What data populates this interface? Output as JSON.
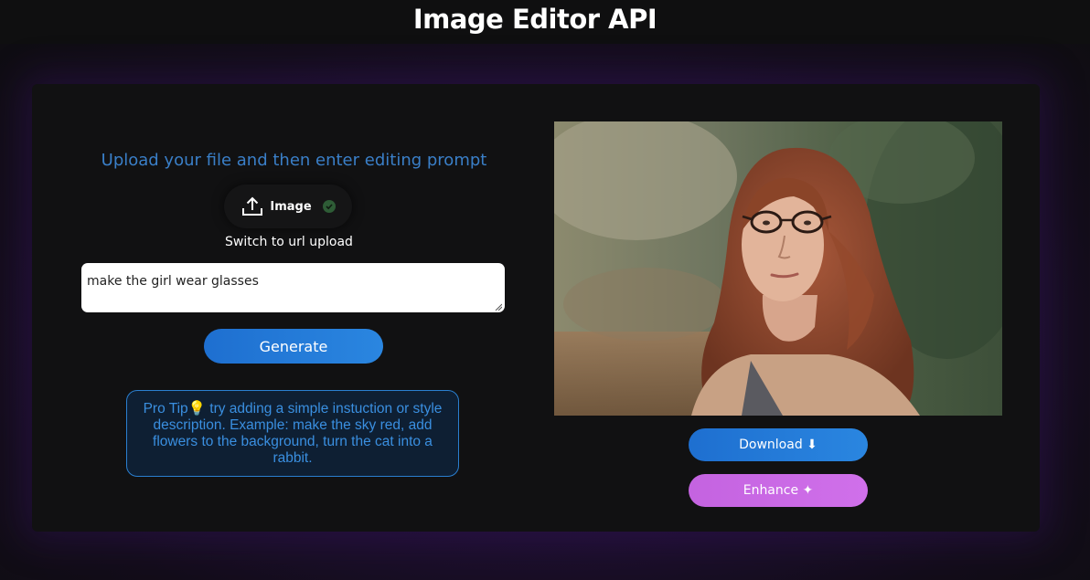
{
  "header": {
    "title": "Image Editor API"
  },
  "left": {
    "instruction": "Upload your file and then enter editing prompt",
    "upload_label": "Image",
    "switch_label": "Switch to url upload",
    "prompt_value": "make the girl wear glasses",
    "generate_label": "Generate",
    "tip_text": "Pro Tip💡 try adding a simple instuction or style description. Example: make the sky red, add flowers to the background, turn the cat into a rabbit."
  },
  "right": {
    "download_label": "Download ⬇",
    "enhance_label": "Enhance ✦"
  },
  "icons": {
    "upload": "upload-icon",
    "check": "check-circle-icon"
  },
  "colors": {
    "accent_blue": "#2a86e0",
    "accent_purple": "#d070ea",
    "instruction_text": "#3a7fc8"
  }
}
